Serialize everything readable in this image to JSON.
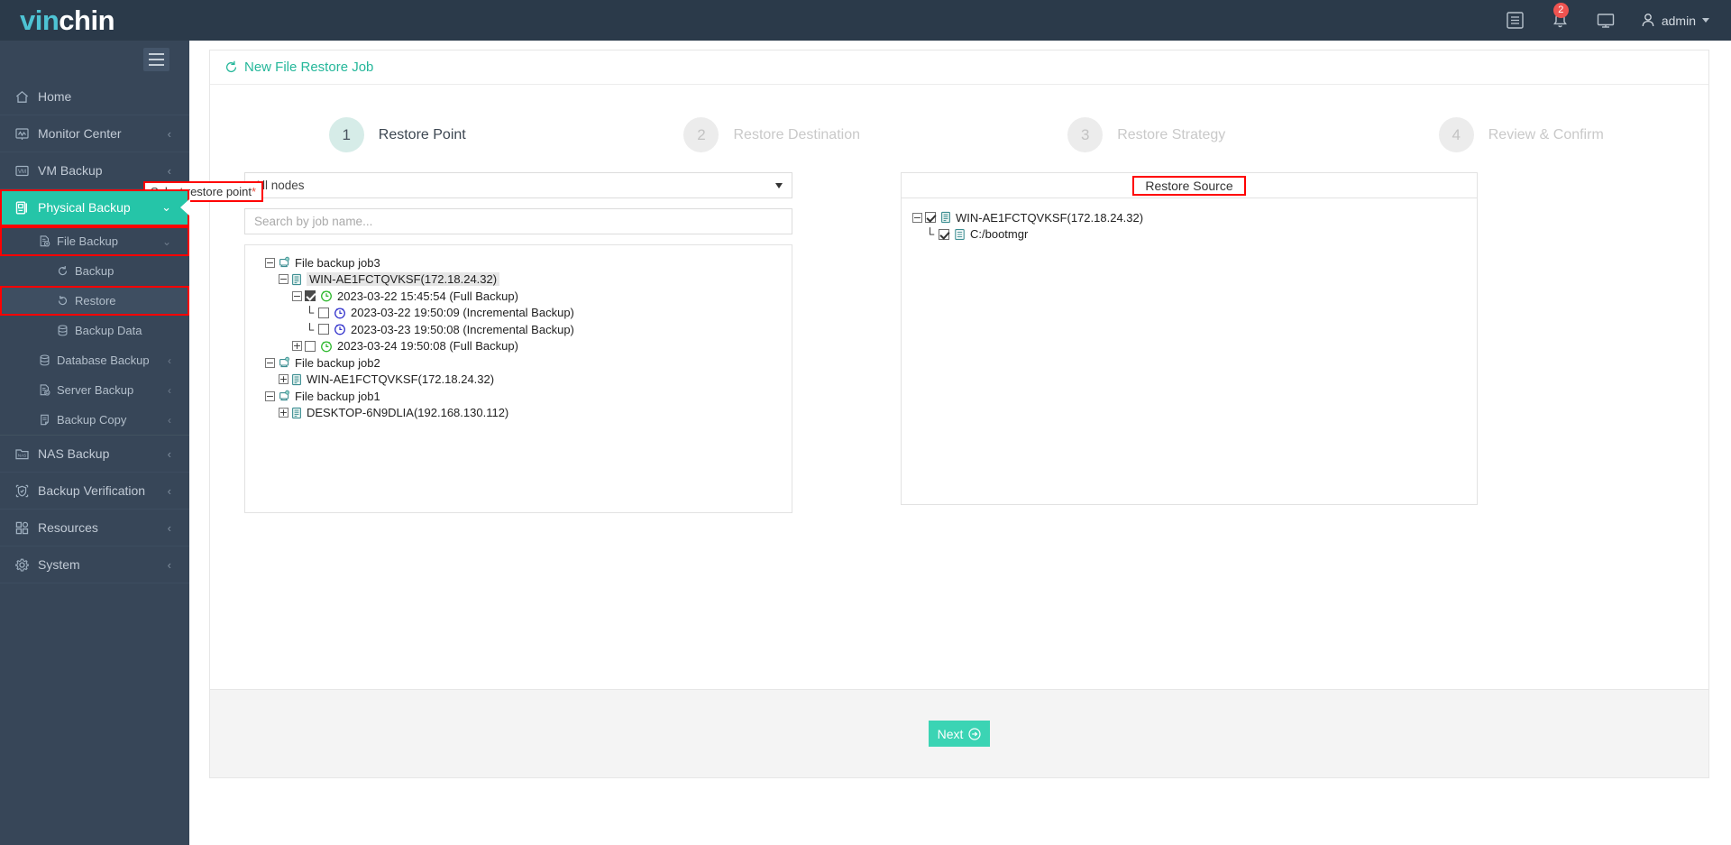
{
  "brand": {
    "part1": "vin",
    "part2": "chin",
    "accent": "#25c5a8"
  },
  "topbar": {
    "logs_icon": "list-icon",
    "notifications_icon": "bell-icon",
    "notification_count": "2",
    "monitor_icon": "display-icon",
    "user_icon": "user-icon",
    "user_name": "admin"
  },
  "sidebar": {
    "toggle_icon": "hamburger-icon",
    "items": [
      {
        "label": "Home",
        "icon": "home-icon",
        "chevron": "",
        "active": false
      },
      {
        "label": "Monitor Center",
        "icon": "monitor-icon",
        "chevron": "‹",
        "active": false
      },
      {
        "label": "VM Backup",
        "icon": "vm-icon",
        "chevron": "‹",
        "active": false
      },
      {
        "label": "Physical Backup",
        "icon": "server-icon",
        "chevron": "⌄",
        "active": true
      }
    ],
    "sub_items": [
      {
        "label": "File Backup",
        "icon": "file-backup-icon",
        "level": 1,
        "chevron": "⌄",
        "highlighted": true
      },
      {
        "label": "Backup",
        "icon": "refresh-icon",
        "level": 2,
        "chevron": "",
        "highlighted": false
      },
      {
        "label": "Restore",
        "icon": "restore-icon",
        "level": 2,
        "chevron": "",
        "highlighted": true,
        "selected": true
      },
      {
        "label": "Backup Data",
        "icon": "database-icon",
        "level": 2,
        "chevron": "",
        "highlighted": false
      },
      {
        "label": "Database Backup",
        "icon": "database-icon",
        "level": 1,
        "chevron": "‹",
        "highlighted": false
      },
      {
        "label": "Server Backup",
        "icon": "server-backup-icon",
        "level": 1,
        "chevron": "‹",
        "highlighted": false
      },
      {
        "label": "Backup Copy",
        "icon": "copy-icon",
        "level": 1,
        "chevron": "‹",
        "highlighted": false
      }
    ],
    "items_bottom": [
      {
        "label": "NAS Backup",
        "icon": "nas-icon",
        "chevron": "‹"
      },
      {
        "label": "Backup Verification",
        "icon": "shield-icon",
        "chevron": "‹"
      },
      {
        "label": "Resources",
        "icon": "grid-icon",
        "chevron": "‹"
      },
      {
        "label": "System",
        "icon": "gear-icon",
        "chevron": "‹"
      }
    ]
  },
  "page": {
    "title": "New File Restore Job",
    "title_icon": "restore-icon"
  },
  "wizard": {
    "steps": [
      {
        "num": "1",
        "label": "Restore Point",
        "state": "done"
      },
      {
        "num": "2",
        "label": "Restore Destination",
        "state": "todo"
      },
      {
        "num": "3",
        "label": "Restore Strategy",
        "state": "todo"
      },
      {
        "num": "4",
        "label": "Review & Confirm",
        "state": "todo"
      }
    ]
  },
  "left_panel": {
    "field_label": "Select restore point",
    "required_mark": "*",
    "node_select_value": "All nodes",
    "node_select_options": [
      "All nodes"
    ],
    "search_placeholder": "Search by job name...",
    "search_value": "",
    "tree": [
      {
        "indent": 0,
        "toggle": "−",
        "icon": "job-icon",
        "checkbox": "none",
        "label": "File backup job3",
        "selected": false
      },
      {
        "indent": 1,
        "toggle": "−",
        "icon": "host-icon",
        "checkbox": "none",
        "label": "WIN-AE1FCTQVKSF(172.18.24.32)",
        "selected": true
      },
      {
        "indent": 2,
        "toggle": "−",
        "icon": "clock-green-icon",
        "checkbox": "checked",
        "label": "2023-03-22 15:45:54 (Full  Backup)",
        "selected": false
      },
      {
        "indent": 3,
        "toggle": "none",
        "icon": "clock-blue-icon",
        "checkbox": "unchecked",
        "label": "2023-03-22 19:50:09 (Incremental  Backup)",
        "selected": false
      },
      {
        "indent": 3,
        "toggle": "none",
        "icon": "clock-blue-icon",
        "checkbox": "unchecked",
        "label": "2023-03-23 19:50:08 (Incremental  Backup)",
        "selected": false
      },
      {
        "indent": 2,
        "toggle": "+",
        "icon": "clock-green-icon",
        "checkbox": "unchecked",
        "label": "2023-03-24 19:50:08 (Full  Backup)",
        "selected": false
      },
      {
        "indent": 0,
        "toggle": "−",
        "icon": "job-icon",
        "checkbox": "none",
        "label": "File backup job2",
        "selected": false
      },
      {
        "indent": 1,
        "toggle": "+",
        "icon": "host-icon",
        "checkbox": "none",
        "label": "WIN-AE1FCTQVKSF(172.18.24.32)",
        "selected": false
      },
      {
        "indent": 0,
        "toggle": "−",
        "icon": "job-icon",
        "checkbox": "none",
        "label": "File backup job1",
        "selected": false
      },
      {
        "indent": 1,
        "toggle": "+",
        "icon": "host-icon",
        "checkbox": "none",
        "label": "DESKTOP-6N9DLIA(192.168.130.112)",
        "selected": false
      }
    ]
  },
  "right_panel": {
    "title": "Restore Source",
    "tree": [
      {
        "indent": 0,
        "toggle": "−",
        "icon": "host-icon",
        "checkbox": "checkmark",
        "label": "WIN-AE1FCTQVKSF(172.18.24.32)"
      },
      {
        "indent": 1,
        "toggle": "none",
        "icon": "file-icon",
        "checkbox": "checkmark",
        "label": "C:/bootmgr"
      }
    ]
  },
  "footer": {
    "next_label": "Next",
    "next_icon": "arrow-right-circle-icon"
  }
}
